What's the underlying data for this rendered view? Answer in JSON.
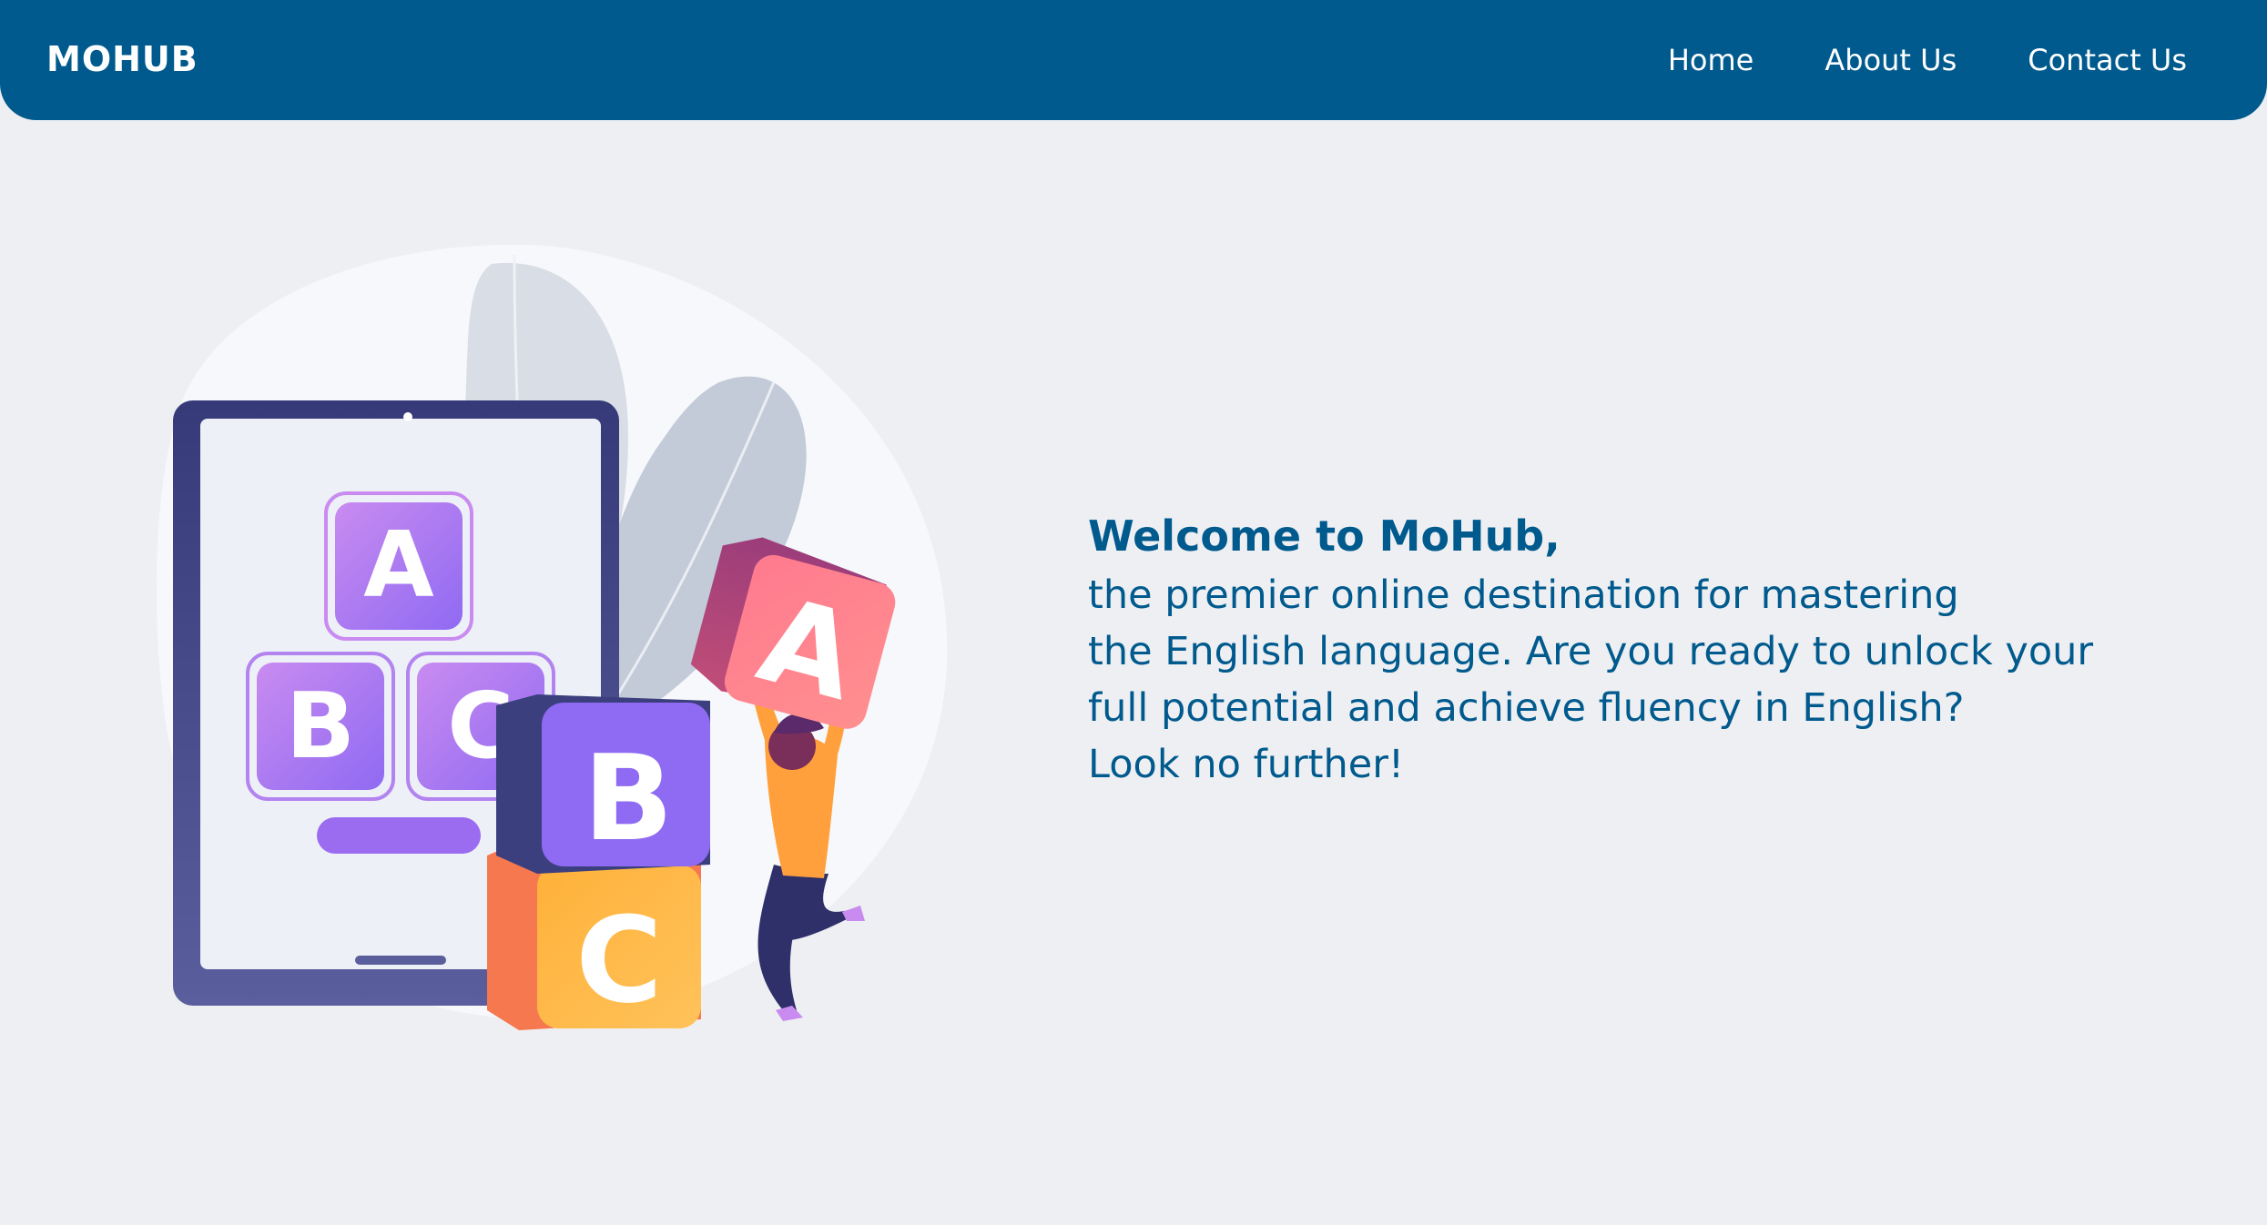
{
  "header": {
    "logo": "MOHUB",
    "nav": [
      {
        "label": "Home"
      },
      {
        "label": "About Us"
      },
      {
        "label": "Contact Us"
      }
    ]
  },
  "hero": {
    "title": "Welcome to MoHub,",
    "lines": [
      "the premier online destination for mastering",
      "the English language. Are you ready to unlock your",
      "full potential and achieve fluency in English?",
      "Look no further!"
    ],
    "illustration": {
      "tablet_blocks": [
        "A",
        "B",
        "C"
      ],
      "stack_blocks": [
        "A",
        "B",
        "C"
      ]
    }
  },
  "colors": {
    "brand": "#005a8d",
    "background": "#eeeff2",
    "purple": "#9b6cf0",
    "pink": "#ff7b8c",
    "orange": "#ffad3c"
  }
}
